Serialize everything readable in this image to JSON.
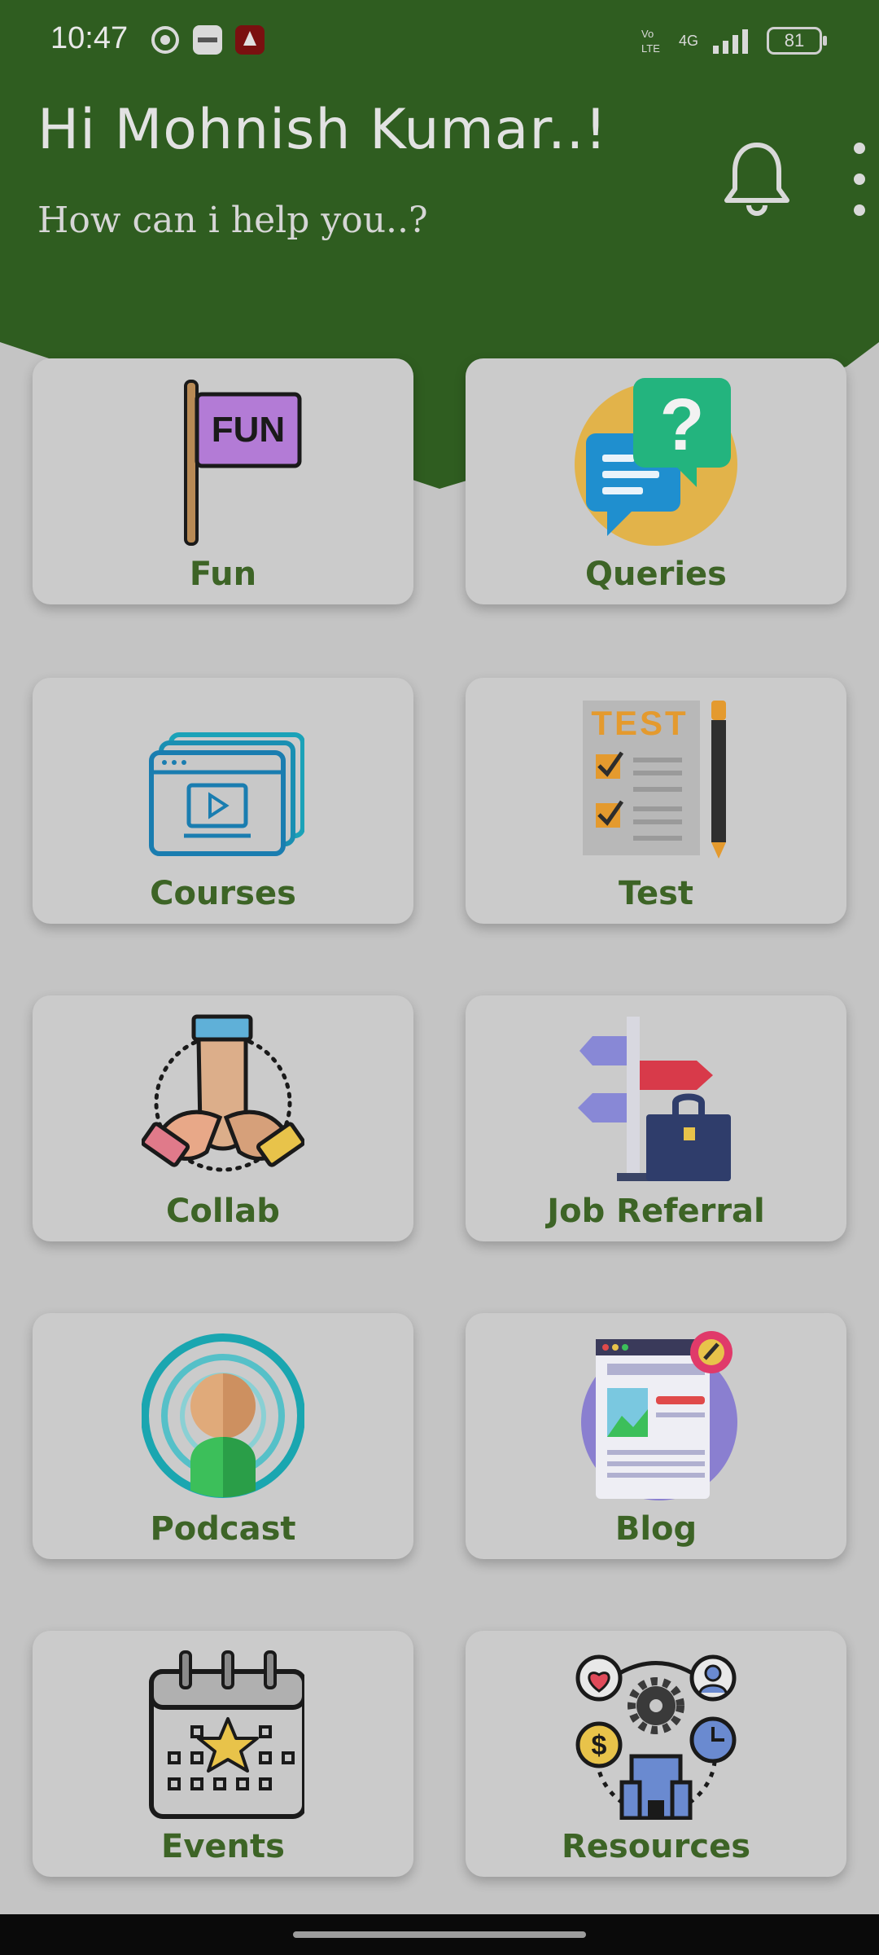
{
  "status_bar": {
    "time": "10:47",
    "network": "4G",
    "battery": "81"
  },
  "header": {
    "greeting": "Hi Mohnish Kumar..!",
    "subtitle": "How can i help you..?",
    "bg_color": "#2f5d20"
  },
  "cards": [
    {
      "label": "Fun",
      "icon": "fun-flag-icon",
      "flag_text": "FUN"
    },
    {
      "label": "Queries",
      "icon": "chat-question-icon"
    },
    {
      "label": "Courses",
      "icon": "video-course-icon"
    },
    {
      "label": "Test",
      "icon": "test-checklist-icon",
      "sheet_text": "TEST"
    },
    {
      "label": "Collab",
      "icon": "hands-together-icon"
    },
    {
      "label": "Job Referral",
      "icon": "signpost-briefcase-icon"
    },
    {
      "label": "Podcast",
      "icon": "podcast-person-icon"
    },
    {
      "label": "Blog",
      "icon": "blog-webpage-icon"
    },
    {
      "label": "Events",
      "icon": "calendar-star-icon"
    },
    {
      "label": "Resources",
      "icon": "resources-network-icon"
    }
  ],
  "colors": {
    "accent_green": "#3d6426",
    "card_bg": "#cbcbcb",
    "page_bg": "#c4c4c4"
  }
}
